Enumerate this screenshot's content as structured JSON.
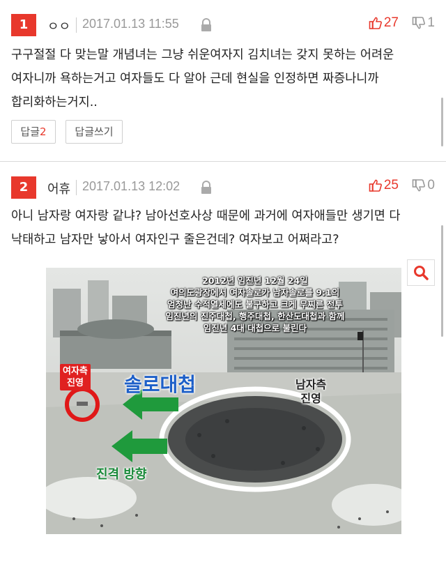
{
  "comments": [
    {
      "rank": "1",
      "nickname": "ㅇㅇ",
      "date": "2017.01.13 11:55",
      "likes": "27",
      "dislikes": "1",
      "text": "구구절절 다 맞는말 개념녀는 그냥 쉬운여자지 김치녀는 갖지 못하는 어려운 여자니까 욕하는거고 여자들도 다 알아 근데 현실을 인정하면 짜증나니까 합리화하는거지..",
      "reply_label": "답글",
      "reply_count": "2",
      "write_reply_label": "답글쓰기"
    },
    {
      "rank": "2",
      "nickname": "어휴",
      "date": "2017.01.13 12:02",
      "likes": "25",
      "dislikes": "0",
      "text": "아니 남자랑 여자랑 같냐? 남아선호사상 때문에 과거에 여자애들만 생기면 다 낙태하고 남자만 낳아서 여자인구 줄은건데? 여자보고 어쩌라고?"
    }
  ],
  "image": {
    "caption_lines": [
      "2012년 임진년 12월 24일",
      "여의도광장에서 여자솔로가 남자솔로를 9:1의",
      "엄청난 수적열세에도 불구하고 크게 무찌른 전투",
      "임진년의 진주대첩, 행주대첩, 한산도대첩과 함께",
      "임진년 4대 대첩으로 불린다"
    ],
    "label_battle": "솔로대첩",
    "label_women_line1": "여자측",
    "label_women_line2": "진영",
    "label_men_line1": "남자측",
    "label_men_line2": "진영",
    "label_direction": "진격 방향"
  },
  "icons": {
    "lock": "lock-icon",
    "like": "thumbs-up-icon",
    "dislike": "thumbs-down-icon",
    "search": "search-icon"
  },
  "colors": {
    "accent": "#e8382c",
    "muted": "#999999"
  }
}
